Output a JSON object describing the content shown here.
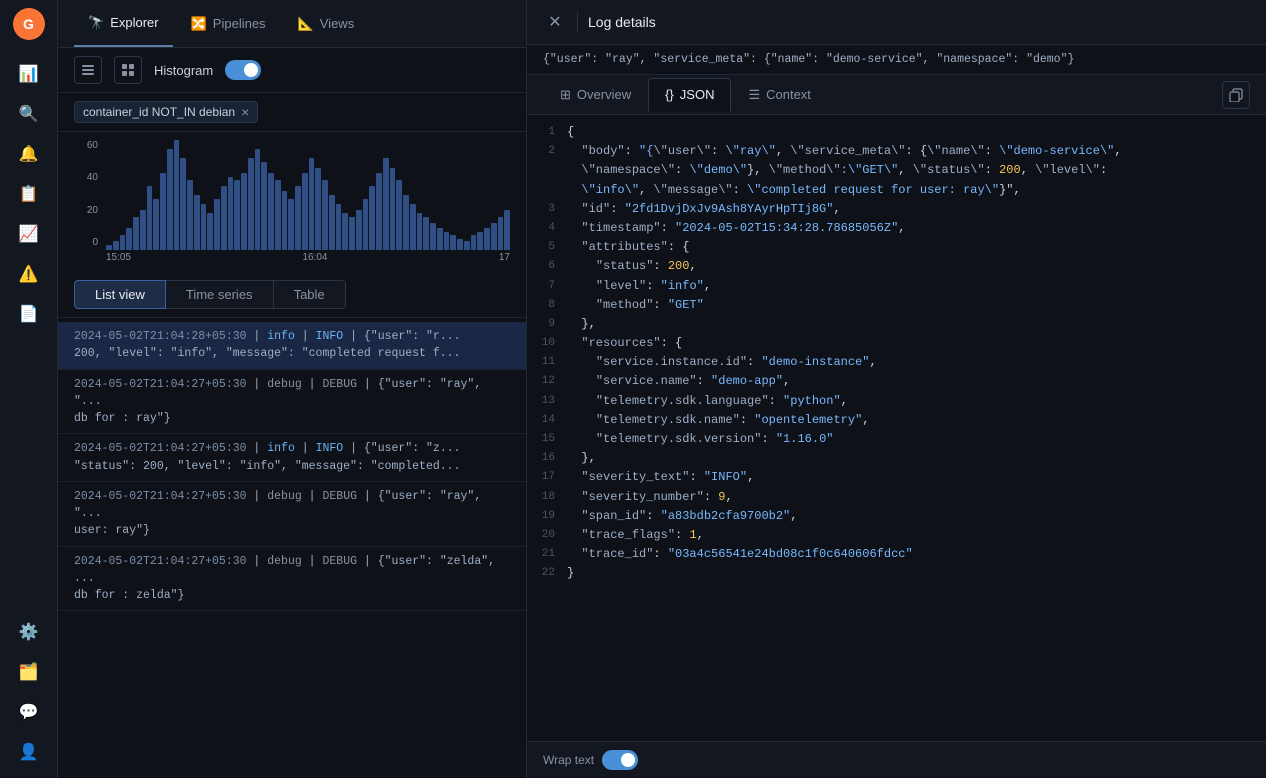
{
  "sidebar": {
    "logo": "G",
    "items": [
      {
        "id": "explore",
        "icon": "📊",
        "label": "Explore",
        "active": false
      },
      {
        "id": "search",
        "icon": "🔍",
        "label": "Search",
        "active": false
      },
      {
        "id": "alerts",
        "icon": "🔔",
        "label": "Alerts",
        "active": false
      },
      {
        "id": "dashboard",
        "icon": "📋",
        "label": "Dashboard",
        "active": false
      },
      {
        "id": "analytics",
        "icon": "📈",
        "label": "Analytics",
        "active": false
      },
      {
        "id": "issues",
        "icon": "⚠️",
        "label": "Issues",
        "active": false
      },
      {
        "id": "reports",
        "icon": "📄",
        "label": "Reports",
        "active": false
      }
    ],
    "bottom_items": [
      {
        "id": "settings",
        "icon": "⚙️",
        "label": "Settings"
      },
      {
        "id": "layers",
        "icon": "🗂️",
        "label": "Layers"
      },
      {
        "id": "feedback",
        "icon": "💬",
        "label": "Feedback"
      },
      {
        "id": "user",
        "icon": "👤",
        "label": "User"
      }
    ]
  },
  "nav_tabs": [
    {
      "id": "explorer",
      "label": "Explorer",
      "icon": "🔭",
      "active": true
    },
    {
      "id": "pipelines",
      "label": "Pipelines",
      "icon": "🔀",
      "active": false
    },
    {
      "id": "views",
      "label": "Views",
      "icon": "📐",
      "active": false
    }
  ],
  "histogram": {
    "label": "Histogram",
    "toggle_on": true
  },
  "filter": {
    "tag_text": "container_id NOT_IN debian",
    "close_symbol": "×"
  },
  "chart": {
    "y_labels": [
      "60",
      "40",
      "20",
      "0"
    ],
    "x_labels": [
      "15:05",
      "16:04",
      "17"
    ],
    "bars": [
      3,
      5,
      8,
      12,
      18,
      22,
      35,
      28,
      42,
      55,
      60,
      50,
      38,
      30,
      25,
      20,
      28,
      35,
      40,
      38,
      42,
      50,
      55,
      48,
      42,
      38,
      32,
      28,
      35,
      42,
      50,
      45,
      38,
      30,
      25,
      20,
      18,
      22,
      28,
      35,
      42,
      50,
      45,
      38,
      30,
      25,
      20,
      18,
      15,
      12,
      10,
      8,
      6,
      5,
      8,
      10,
      12,
      15,
      18,
      22
    ]
  },
  "view_tabs": [
    {
      "id": "list",
      "label": "List view",
      "active": true
    },
    {
      "id": "timeseries",
      "label": "Time series",
      "active": false
    },
    {
      "id": "table",
      "label": "Table",
      "active": false
    }
  ],
  "log_rows": [
    {
      "id": 1,
      "timestamp": "2024-05-02T21:04:28+05:30",
      "level": "info",
      "level_label": "INFO",
      "body": "{\"user\": \"r...",
      "detail": "200, \"level\": \"info\", \"message\": \"completed request f..."
    },
    {
      "id": 2,
      "timestamp": "2024-05-02T21:04:27+05:30",
      "level": "debug",
      "level_label": "DEBUG",
      "body": "{\"user\": \"ray\", \"...",
      "detail": "db for : ray\"}"
    },
    {
      "id": 3,
      "timestamp": "2024-05-02T21:04:27+05:30",
      "level": "info",
      "level_label": "INFO",
      "body": "{\"user\": \"z...",
      "detail": "\"status\": 200, \"level\": \"info\", \"message\": \"completed..."
    },
    {
      "id": 4,
      "timestamp": "2024-05-02T21:04:27+05:30",
      "level": "debug",
      "level_label": "DEBUG",
      "body": "{\"user\": \"ray\", \"...",
      "detail": "user: ray\"}"
    },
    {
      "id": 5,
      "timestamp": "2024-05-02T21:04:27+05:30",
      "level": "debug",
      "level_label": "DEBUG",
      "body": "{\"user\": \"zelda\", ...",
      "detail": "db for : zelda\"}"
    }
  ],
  "log_details": {
    "title": "Log details",
    "preview": "{\"user\": \"ray\", \"service_meta\": {\"name\": \"demo-service\", \"namespace\": \"demo\"}",
    "tabs": [
      {
        "id": "overview",
        "label": "Overview",
        "icon": "⊞",
        "active": false
      },
      {
        "id": "json",
        "label": "JSON",
        "icon": "{}",
        "active": true
      },
      {
        "id": "context",
        "label": "Context",
        "icon": "☰",
        "active": false
      }
    ],
    "json_lines": [
      {
        "num": 1,
        "content": "{"
      },
      {
        "num": 2,
        "content": "  \"body\": \"{\\\"user\\\": \\\"ray\\\", \\\"service_meta\\\": {\\\"name\\\": \\\"demo-service\\\",\\n  \\\"namespace\\\": \\\"demo\\\"}, \\\"method\\\":\\\"GET\\\", \\\"status\\\": 200, \\\"level\\\":\\n  \\\"info\\\", \\\"message\\\": \\\"completed request for user: ray\\\"}\","
      },
      {
        "num": 3,
        "content": "  \"id\": \"2fd1DvjDxJv9Ash8YAyrHpTIj8G\","
      },
      {
        "num": 4,
        "content": "  \"timestamp\": \"2024-05-02T15:34:28.78685056Z\","
      },
      {
        "num": 5,
        "content": "  \"attributes\": {"
      },
      {
        "num": 6,
        "content": "    \"status\": 200,"
      },
      {
        "num": 7,
        "content": "    \"level\": \"info\","
      },
      {
        "num": 8,
        "content": "    \"method\": \"GET\""
      },
      {
        "num": 9,
        "content": "  },"
      },
      {
        "num": 10,
        "content": "  \"resources\": {"
      },
      {
        "num": 11,
        "content": "    \"service.instance.id\": \"demo-instance\","
      },
      {
        "num": 12,
        "content": "    \"service.name\": \"demo-app\","
      },
      {
        "num": 13,
        "content": "    \"telemetry.sdk.language\": \"python\","
      },
      {
        "num": 14,
        "content": "    \"telemetry.sdk.name\": \"opentelemetry\","
      },
      {
        "num": 15,
        "content": "    \"telemetry.sdk.version\": \"1.16.0\""
      },
      {
        "num": 16,
        "content": "  },"
      },
      {
        "num": 17,
        "content": "  \"severity_text\": \"INFO\","
      },
      {
        "num": 18,
        "content": "  \"severity_number\": 9,"
      },
      {
        "num": 19,
        "content": "  \"span_id\": \"a83bdb2cfa9700b2\","
      },
      {
        "num": 20,
        "content": "  \"trace_flags\": 1,"
      },
      {
        "num": 21,
        "content": "  \"trace_id\": \"03a4c56541e24bd08c1f0c640606fdcc\""
      },
      {
        "num": 22,
        "content": "}"
      }
    ],
    "wrap_text_label": "Wrap text",
    "wrap_text_on": true
  }
}
